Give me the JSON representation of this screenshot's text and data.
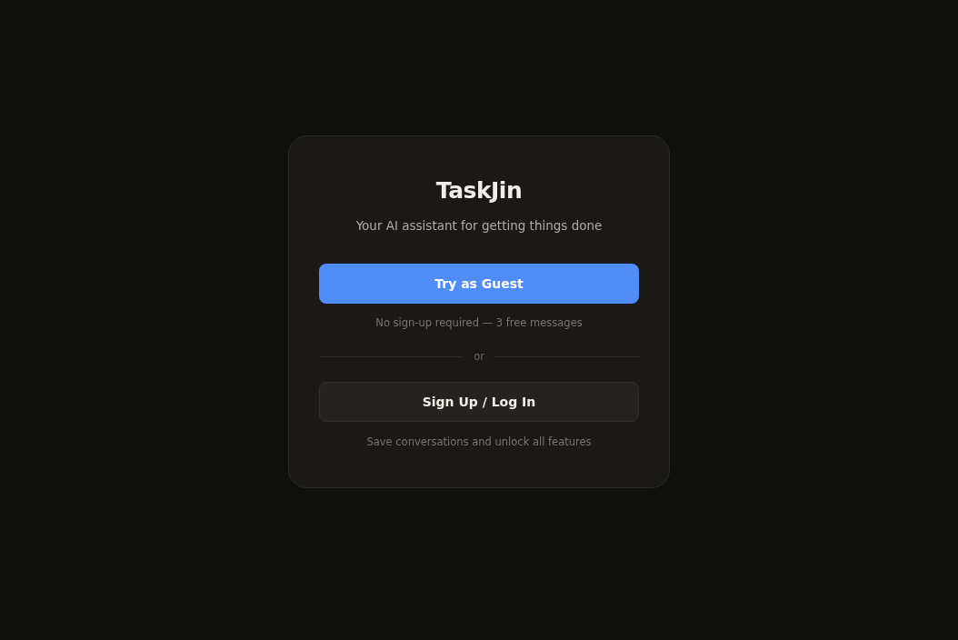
{
  "title": "TaskJin",
  "subtitle": "Your AI assistant for getting things done",
  "guest_button": "Try as Guest",
  "guest_note": "No sign-up required — 3 free messages",
  "divider": "or",
  "signup_button": "Sign Up / Log In",
  "signup_note": "Save conversations and unlock all features"
}
